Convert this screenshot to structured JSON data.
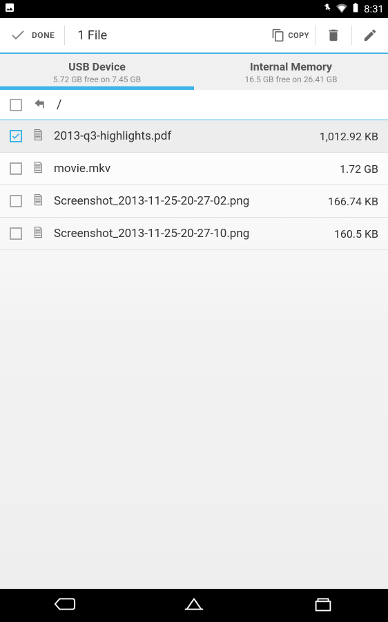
{
  "status": {
    "time": "8:31"
  },
  "actionBar": {
    "done": "DONE",
    "count": "1 File",
    "copy": "COPY"
  },
  "tabs": [
    {
      "title": "USB Device",
      "sub": "5.72 GB free on 7.45 GB",
      "active": true
    },
    {
      "title": "Internal Memory",
      "sub": "16.5 GB free on 26.41 GB",
      "active": false
    }
  ],
  "path": "/",
  "files": [
    {
      "name": "2013-q3-highlights.pdf",
      "size": "1,012.92 KB",
      "selected": true
    },
    {
      "name": "movie.mkv",
      "size": "1.72 GB",
      "selected": false
    },
    {
      "name": "Screenshot_2013-11-25-20-27-02.png",
      "size": "166.74 KB",
      "selected": false
    },
    {
      "name": "Screenshot_2013-11-25-20-27-10.png",
      "size": "160.5 KB",
      "selected": false
    }
  ]
}
